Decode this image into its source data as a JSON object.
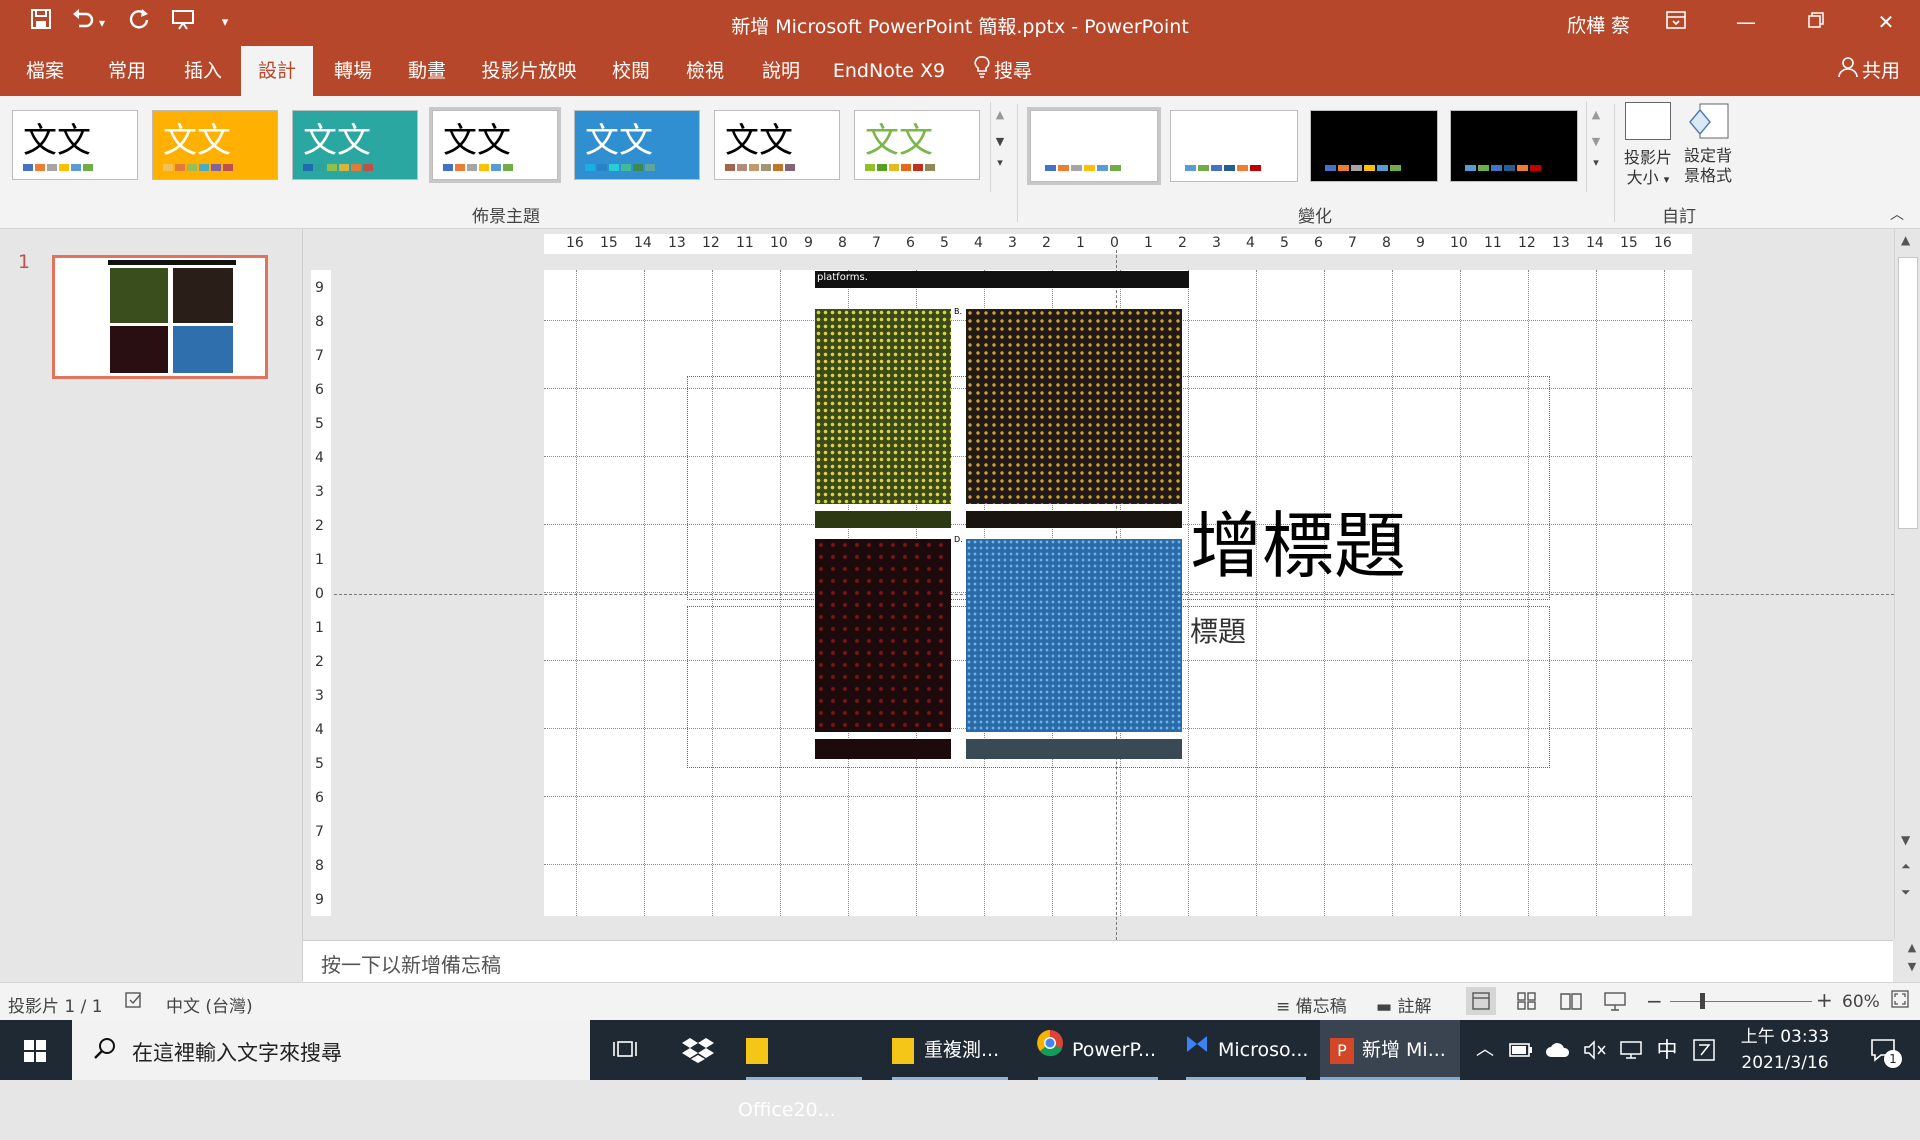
{
  "window": {
    "title": "新增 Microsoft PowerPoint 簡報.pptx  -  PowerPoint",
    "user": "欣樺 蔡"
  },
  "ribbon_tabs": [
    "檔案",
    "常用",
    "插入",
    "設計",
    "轉場",
    "動畫",
    "投影片放映",
    "校閱",
    "檢視",
    "說明",
    "EndNote X9",
    "搜尋"
  ],
  "active_tab": "設計",
  "share_label": "共用",
  "themes": {
    "group_label": "佈景主題",
    "sample_text": "文文",
    "items": [
      {
        "bg": "#ffffff",
        "fg": "#000000",
        "colors": [
          "#4472c4",
          "#ed7d31",
          "#a5a5a5",
          "#ffc000",
          "#5b9bd5",
          "#70ad47"
        ]
      },
      {
        "bg": "#ffb000",
        "fg": "#ffffff",
        "colors": [
          "#f3c05a",
          "#e07b39",
          "#9bbb59",
          "#4bacc6",
          "#8064a2",
          "#c0504d"
        ]
      },
      {
        "bg": "#2aa7a0",
        "fg": "#ffffff",
        "colors": [
          "#1f6bb0",
          "#2ba39a",
          "#8ec04a",
          "#d9b43a",
          "#e07b39",
          "#c0504d"
        ]
      },
      {
        "bg": "#ffffff",
        "fg": "#000000",
        "colors": [
          "#4472c4",
          "#ed7d31",
          "#a5a5a5",
          "#ffc000",
          "#5b9bd5",
          "#70ad47"
        ]
      },
      {
        "bg": "#2f8fd0",
        "fg": "#ffffff",
        "colors": [
          "#1cade4",
          "#2683c6",
          "#27ced7",
          "#42ba97",
          "#3e8853",
          "#62a39f"
        ]
      },
      {
        "bg": "#ffffff",
        "fg": "#000000",
        "colors": [
          "#a5644e",
          "#b58b80",
          "#c3986d",
          "#a19574",
          "#c17529",
          "#826277"
        ]
      },
      {
        "bg": "#ffffff",
        "fg": "#7ab648",
        "colors": [
          "#90c226",
          "#54a021",
          "#e6b91e",
          "#e76618",
          "#c42f1a",
          "#918655"
        ]
      }
    ]
  },
  "variants": {
    "group_label": "變化",
    "items": [
      {
        "bg": "#ffffff",
        "colors": [
          "#4472c4",
          "#ed7d31",
          "#a5a5a5",
          "#ffc000",
          "#5b9bd5",
          "#70ad47"
        ]
      },
      {
        "bg": "#ffffff",
        "colors": [
          "#5b9bd5",
          "#70ad47",
          "#4472c4",
          "#255e91",
          "#ed7d31",
          "#c00000"
        ]
      },
      {
        "bg": "#000000",
        "colors": [
          "#4472c4",
          "#ed7d31",
          "#a5a5a5",
          "#ffc000",
          "#5b9bd5",
          "#70ad47"
        ]
      },
      {
        "bg": "#000000",
        "colors": [
          "#5b9bd5",
          "#70ad47",
          "#4472c4",
          "#255e91",
          "#ed7d31",
          "#c00000"
        ]
      }
    ]
  },
  "customize": {
    "group_label": "自訂",
    "slide_size_line1": "投影片",
    "slide_size_line2": "大小",
    "format_bg_line1": "設定背",
    "format_bg_line2": "景格式"
  },
  "slides_pane": {
    "slide_number": "1"
  },
  "slide": {
    "image_caption": "platforms.",
    "panel_labels": [
      "B.",
      "D."
    ],
    "title_text": "增標題",
    "subtitle_text": "標題"
  },
  "ruler": {
    "horizontal": [
      "16",
      "15",
      "14",
      "13",
      "12",
      "11",
      "10",
      "9",
      "8",
      "7",
      "6",
      "5",
      "4",
      "3",
      "2",
      "1",
      "0",
      "1",
      "2",
      "3",
      "4",
      "5",
      "6",
      "7",
      "8",
      "9",
      "10",
      "11",
      "12",
      "13",
      "14",
      "15",
      "16"
    ],
    "vertical": [
      "9",
      "8",
      "7",
      "6",
      "5",
      "4",
      "3",
      "2",
      "1",
      "0",
      "1",
      "2",
      "3",
      "4",
      "5",
      "6",
      "7",
      "8",
      "9"
    ]
  },
  "notes_placeholder": "按一下以新增備忘稿",
  "status": {
    "slide_info": "投影片 1 / 1",
    "language": "中文 (台灣)",
    "notes_label": "備忘稿",
    "comments_label": "註解",
    "zoom": "60%"
  },
  "taskbar": {
    "search_placeholder": "在這裡輸入文字來搜尋",
    "apps": [
      "Office20...",
      "重複測...",
      "PowerP...",
      "Microso...",
      "新增 Mi..."
    ],
    "ime": "中",
    "time": "上午 03:33",
    "date": "2021/3/16",
    "notification_count": "1"
  }
}
